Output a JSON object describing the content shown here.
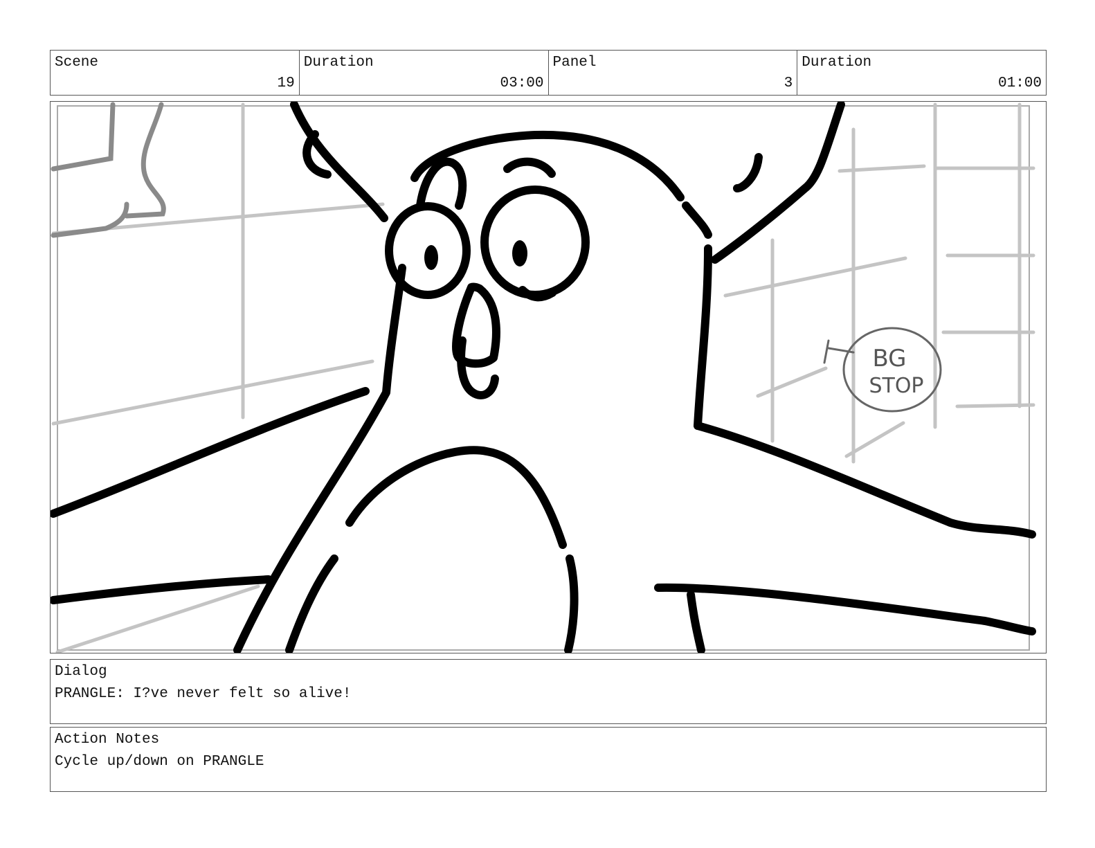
{
  "header": {
    "scene_label": "Scene",
    "scene_value": "19",
    "scene_duration_label": "Duration",
    "scene_duration_value": "03:00",
    "panel_label": "Panel",
    "panel_value": "3",
    "panel_duration_label": "Duration",
    "panel_duration_value": "01:00"
  },
  "sketch": {
    "note": "BG STOP",
    "note_line1": "BG",
    "note_line2": "STOP"
  },
  "dialog": {
    "label": "Dialog",
    "text": "PRANGLE: I?ve never felt so alive!"
  },
  "action_notes": {
    "label": "Action Notes",
    "text": "Cycle up/down on PRANGLE"
  }
}
